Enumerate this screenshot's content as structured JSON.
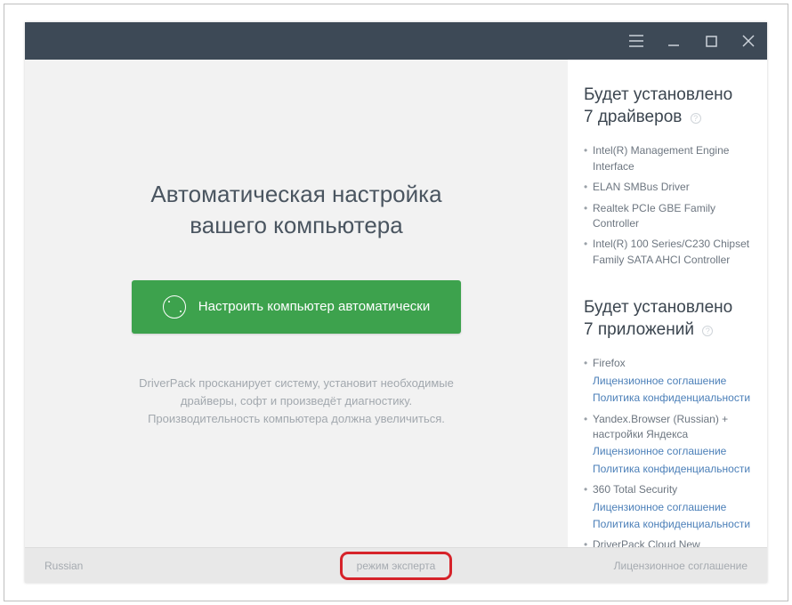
{
  "main": {
    "headline_l1": "Автоматическая настройка",
    "headline_l2": "вашего компьютера",
    "cta_label": "Настроить компьютер автоматически",
    "desc_l1": "DriverPack просканирует систему, установит необходимые",
    "desc_l2": "драйверы, софт и произведёт диагностику.",
    "desc_l3": "Производительность компьютера должна увеличиться."
  },
  "sidebar": {
    "drivers_head_l1": "Будет установлено",
    "drivers_head_l2": "7 драйверов",
    "drivers": [
      "Intel(R) Management Engine Interface",
      "ELAN SMBus Driver",
      "Realtek PCIe GBE Family Controller",
      "Intel(R) 100 Series/C230 Chipset Family SATA AHCI Controller"
    ],
    "apps_head_l1": "Будет установлено",
    "apps_head_l2": "7 приложений",
    "apps": [
      {
        "name": "Firefox",
        "license": "Лицензионное соглашение",
        "privacy": "Политика конфиденциальности"
      },
      {
        "name": "Yandex.Browser (Russian) + настройки Яндекса",
        "license": "Лицензионное соглашение",
        "privacy": "Политика конфиденциальности"
      },
      {
        "name": "360 Total Security",
        "license": "Лицензионное соглашение",
        "privacy": "Политика конфиденциальности"
      },
      {
        "name": "DriverPack Cloud New",
        "license": "",
        "privacy": ""
      }
    ]
  },
  "footer": {
    "language": "Russian",
    "expert_mode": "режим эксперта",
    "license": "Лицензионное соглашение"
  }
}
